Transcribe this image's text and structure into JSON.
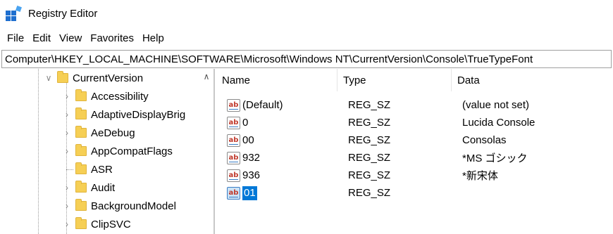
{
  "window": {
    "title": "Registry Editor",
    "icon": "registry-editor-icon"
  },
  "menu": [
    "File",
    "Edit",
    "View",
    "Favorites",
    "Help"
  ],
  "address": "Computer\\HKEY_LOCAL_MACHINE\\SOFTWARE\\Microsoft\\Windows NT\\CurrentVersion\\Console\\TrueTypeFont",
  "tree": [
    {
      "label": "CurrentVersion",
      "expanded": true
    },
    {
      "label": "Accessibility",
      "expanded": false
    },
    {
      "label": "AdaptiveDisplayBrig",
      "expanded": false
    },
    {
      "label": "AeDebug",
      "expanded": false
    },
    {
      "label": "AppCompatFlags",
      "expanded": false
    },
    {
      "label": "ASR",
      "expanded": null
    },
    {
      "label": "Audit",
      "expanded": false
    },
    {
      "label": "BackgroundModel",
      "expanded": false
    },
    {
      "label": "ClipSVC",
      "expanded": false
    }
  ],
  "columns": {
    "name": "Name",
    "type": "Type",
    "data": "Data"
  },
  "values": [
    {
      "name": "(Default)",
      "type": "REG_SZ",
      "data": "(value not set)",
      "icon": "ab"
    },
    {
      "name": "0",
      "type": "REG_SZ",
      "data": "Lucida Console",
      "icon": "ab"
    },
    {
      "name": "00",
      "type": "REG_SZ",
      "data": "Consolas",
      "icon": "ab"
    },
    {
      "name": "932",
      "type": "REG_SZ",
      "data": "*MS ゴシック",
      "icon": "ab"
    },
    {
      "name": "936",
      "type": "REG_SZ",
      "data": "*新宋体",
      "icon": "ab"
    },
    {
      "name": "01",
      "type": "REG_SZ",
      "data": "",
      "icon": "ab",
      "selected": true
    }
  ],
  "colors": {
    "selection": "#0078d7",
    "folder": "#f6cf55",
    "accent": "#1f6fcf"
  }
}
